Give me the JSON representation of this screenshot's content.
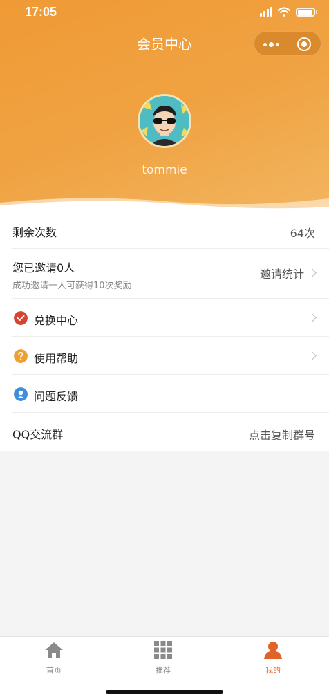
{
  "status_bar": {
    "time": "17:05"
  },
  "nav": {
    "title": "会员中心"
  },
  "profile": {
    "username": "tommie"
  },
  "rows": {
    "remaining": {
      "label": "剩余次数",
      "value": "64次"
    },
    "invite": {
      "label": "您已邀请0人",
      "sub": "成功邀请一人可获得10次奖励",
      "value": "邀请统计"
    },
    "exchange": {
      "label": "兑换中心"
    },
    "help": {
      "label": "使用帮助"
    },
    "feedback": {
      "label": "问题反馈"
    },
    "qq": {
      "label": "QQ交流群",
      "value": "点击复制群号"
    }
  },
  "tabbar": {
    "home": "首页",
    "recommend": "推荐",
    "mine": "我的"
  },
  "colors": {
    "header_orange": "#ef9a35",
    "active_tab": "#e0642a",
    "exchange_icon": "#d8452f",
    "help_icon": "#f0a030",
    "feedback_icon": "#3c8fe0"
  }
}
